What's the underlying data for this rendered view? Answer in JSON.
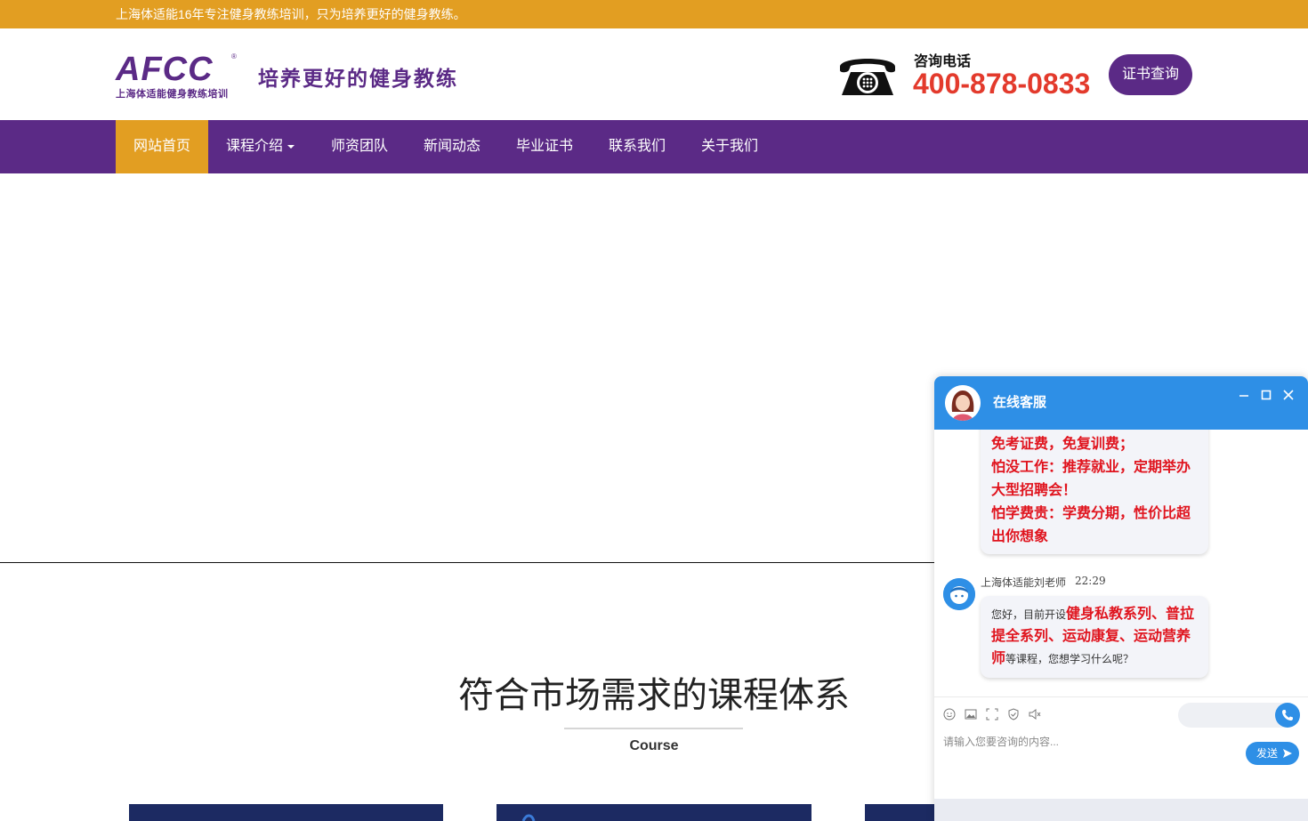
{
  "topbar": {
    "text": "上海体适能16年专注健身教练培训，只为培养更好的健身教练。"
  },
  "header": {
    "logo_mark": "AFCC",
    "logo_reg": "®",
    "logo_sub": "上海体适能健身教练培训",
    "slogan": "培养更好的健身教练",
    "phone_label": "咨询电话",
    "phone_number": "400-878-0833",
    "cert_button": "证书查询"
  },
  "nav": {
    "items": [
      {
        "label": "网站首页",
        "active": true
      },
      {
        "label": "课程介绍",
        "has_dropdown": true
      },
      {
        "label": "师资团队"
      },
      {
        "label": "新闻动态"
      },
      {
        "label": "毕业证书"
      },
      {
        "label": "联系我们"
      },
      {
        "label": "关于我们"
      }
    ]
  },
  "section": {
    "title": "符合市场需求的课程体系",
    "subtitle": "Course"
  },
  "chat": {
    "title": "在线客服",
    "message1": {
      "line1": "免考证费，免复训费；",
      "line2": "怕没工作：推荐就业，定期举办大型招聘会！",
      "line3": "怕学费贵：学费分期，性价比超出你想象"
    },
    "agent_name": "上海体适能刘老师",
    "agent_time": "22:29",
    "message2": {
      "prefix": "您好，目前开设",
      "highlight": "健身私教系列、普拉提全系列、运动康复、运动营养师",
      "suffix": "等课程，您想学习什么呢？"
    },
    "input_placeholder": "请输入您要咨询的内容...",
    "send_label": "发送"
  },
  "colors": {
    "brand_purple": "#5b2a86",
    "accent_orange": "#e29e22",
    "phone_red": "#e33a2c",
    "chat_blue": "#2e8fe6",
    "alert_red": "#e0141e"
  }
}
